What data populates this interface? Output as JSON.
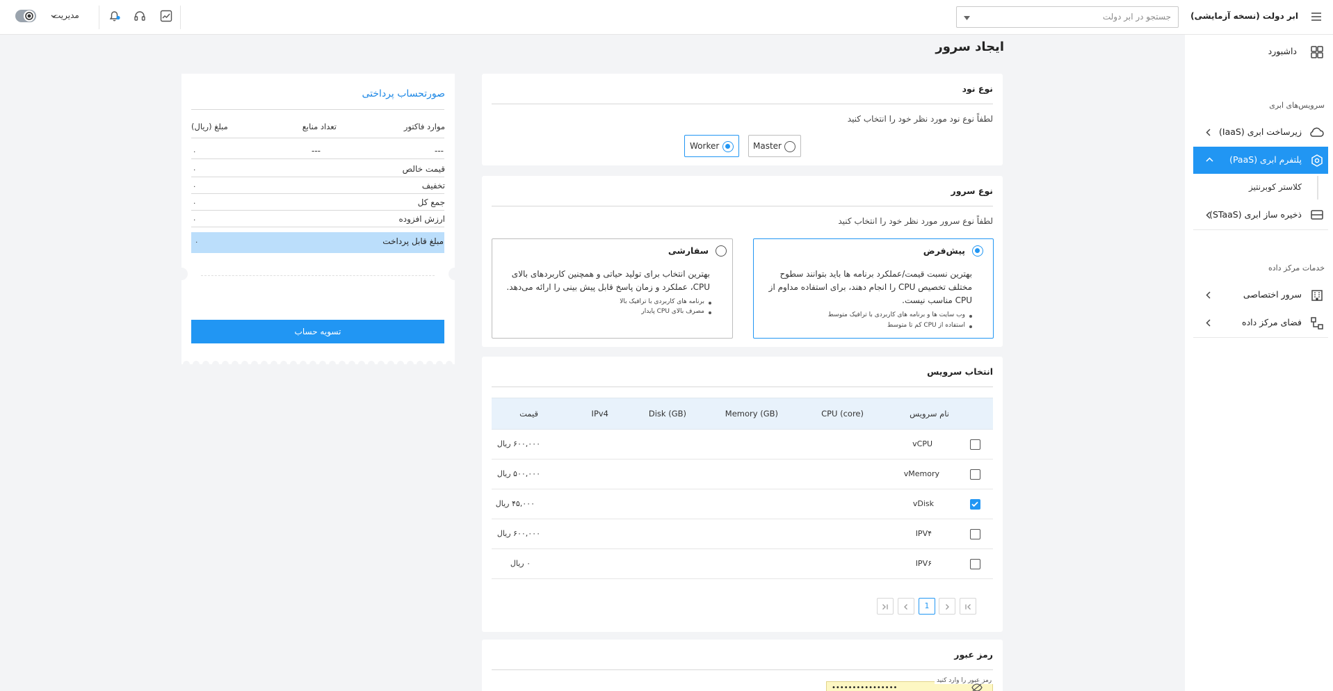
{
  "app": {
    "title": "ابر دولت (نسخه آزمایشی)"
  },
  "topbar": {
    "search_placeholder": "جستجو در ابر دولت",
    "user_menu": "مدیریت",
    "icons": [
      "menu-icon",
      "chart-icon",
      "headset-icon",
      "bell-icon",
      "theme-toggle-icon"
    ]
  },
  "sidebar": {
    "dashboard": "داشبورد",
    "section_cloud": "سرویس‌های ابری",
    "iaas": "زیرساخت ابری (IaaS)",
    "paas": "پلتفرم ابری (PaaS)",
    "paas_sub": "کلاستر کوبرنتیز",
    "staas": "ذخیره ساز ابری (STaaS)",
    "section_dc": "خدمات مرکز داده",
    "private_server": "سرور اختصاصی",
    "dc_space": "فضای مرکز داده"
  },
  "page": {
    "title": "ایجاد سرور"
  },
  "node_type": {
    "title": "نوع نود",
    "hint": "لطفاً نوع نود مورد نظر خود را انتخاب کنید",
    "options": [
      "Master",
      "Worker"
    ],
    "selected": "Worker"
  },
  "server_type": {
    "title": "نوع سرور",
    "hint": "لطفاً نوع سرور مورد نظر خود را انتخاب کنید",
    "default": {
      "title": "پیش‌فرض",
      "desc": "بهترین نسبت قیمت/عملکرد برنامه ها باید بتوانند سطوح مختلف تخصیص CPU را انجام دهند، برای استفاده مداوم از CPU مناسب نیست.",
      "bullets": [
        "وب سایت ها و برنامه های کاربردی با ترافیک متوسط",
        "استفاده از CPU کم تا متوسط"
      ],
      "selected": true
    },
    "custom": {
      "title": "سفارشی",
      "desc": "بهترین انتخاب برای تولید حیاتی و همچنین کاربردهای بالای CPU، عملکرد و زمان پاسخ قابل پیش بینی را ارائه می‌دهد.",
      "bullets": [
        "برنامه های کاربردی با ترافیک بالا",
        "مصرف بالای CPU پایدار"
      ],
      "selected": false
    }
  },
  "services": {
    "title": "انتخاب سرویس",
    "columns": [
      "نام سرویس",
      "CPU (core)",
      "Memory (GB)",
      "Disk (GB)",
      "IPv4",
      "قیمت"
    ],
    "rows": [
      {
        "name": "vCPU",
        "price": "۶۰۰,۰۰۰ ریال",
        "checked": false
      },
      {
        "name": "vMemory",
        "price": "۵۰۰,۰۰۰ ریال",
        "checked": false
      },
      {
        "name": "vDisk",
        "price": "۴۵,۰۰۰ ریال",
        "checked": true
      },
      {
        "name": "IPV۴",
        "price": "۶۰۰,۰۰۰ ریال",
        "checked": false
      },
      {
        "name": "IPV۶",
        "price": "۰ ریال",
        "checked": false
      }
    ],
    "pagination": {
      "current": "1"
    }
  },
  "password": {
    "title": "رمز عبور",
    "label": "رمز عبور را وارد کنید",
    "value": "••••••••••••••••"
  },
  "invoice": {
    "title": "صورتحساب پرداختی",
    "columns": [
      "موارد فاکتور",
      "تعداد منابع",
      "مبلغ (ریال)"
    ],
    "empty_row": [
      "---",
      "---",
      "۰"
    ],
    "net_price_label": "قیمت خالص",
    "net_price": "۰",
    "discount_label": "تخفیف",
    "discount": "۰",
    "total_label": "جمع کل",
    "total": "۰",
    "vat_label": "ارزش افزوده",
    "vat": "۰",
    "payable_label": "مبلغ قابل پرداخت",
    "payable": "۰",
    "checkout": "تسویه حساب"
  },
  "colors": {
    "accent": "#2196f3",
    "accent_light": "#bbdefb",
    "page_bg": "#f3f4f6",
    "password_bg": "#fdf7c3"
  }
}
